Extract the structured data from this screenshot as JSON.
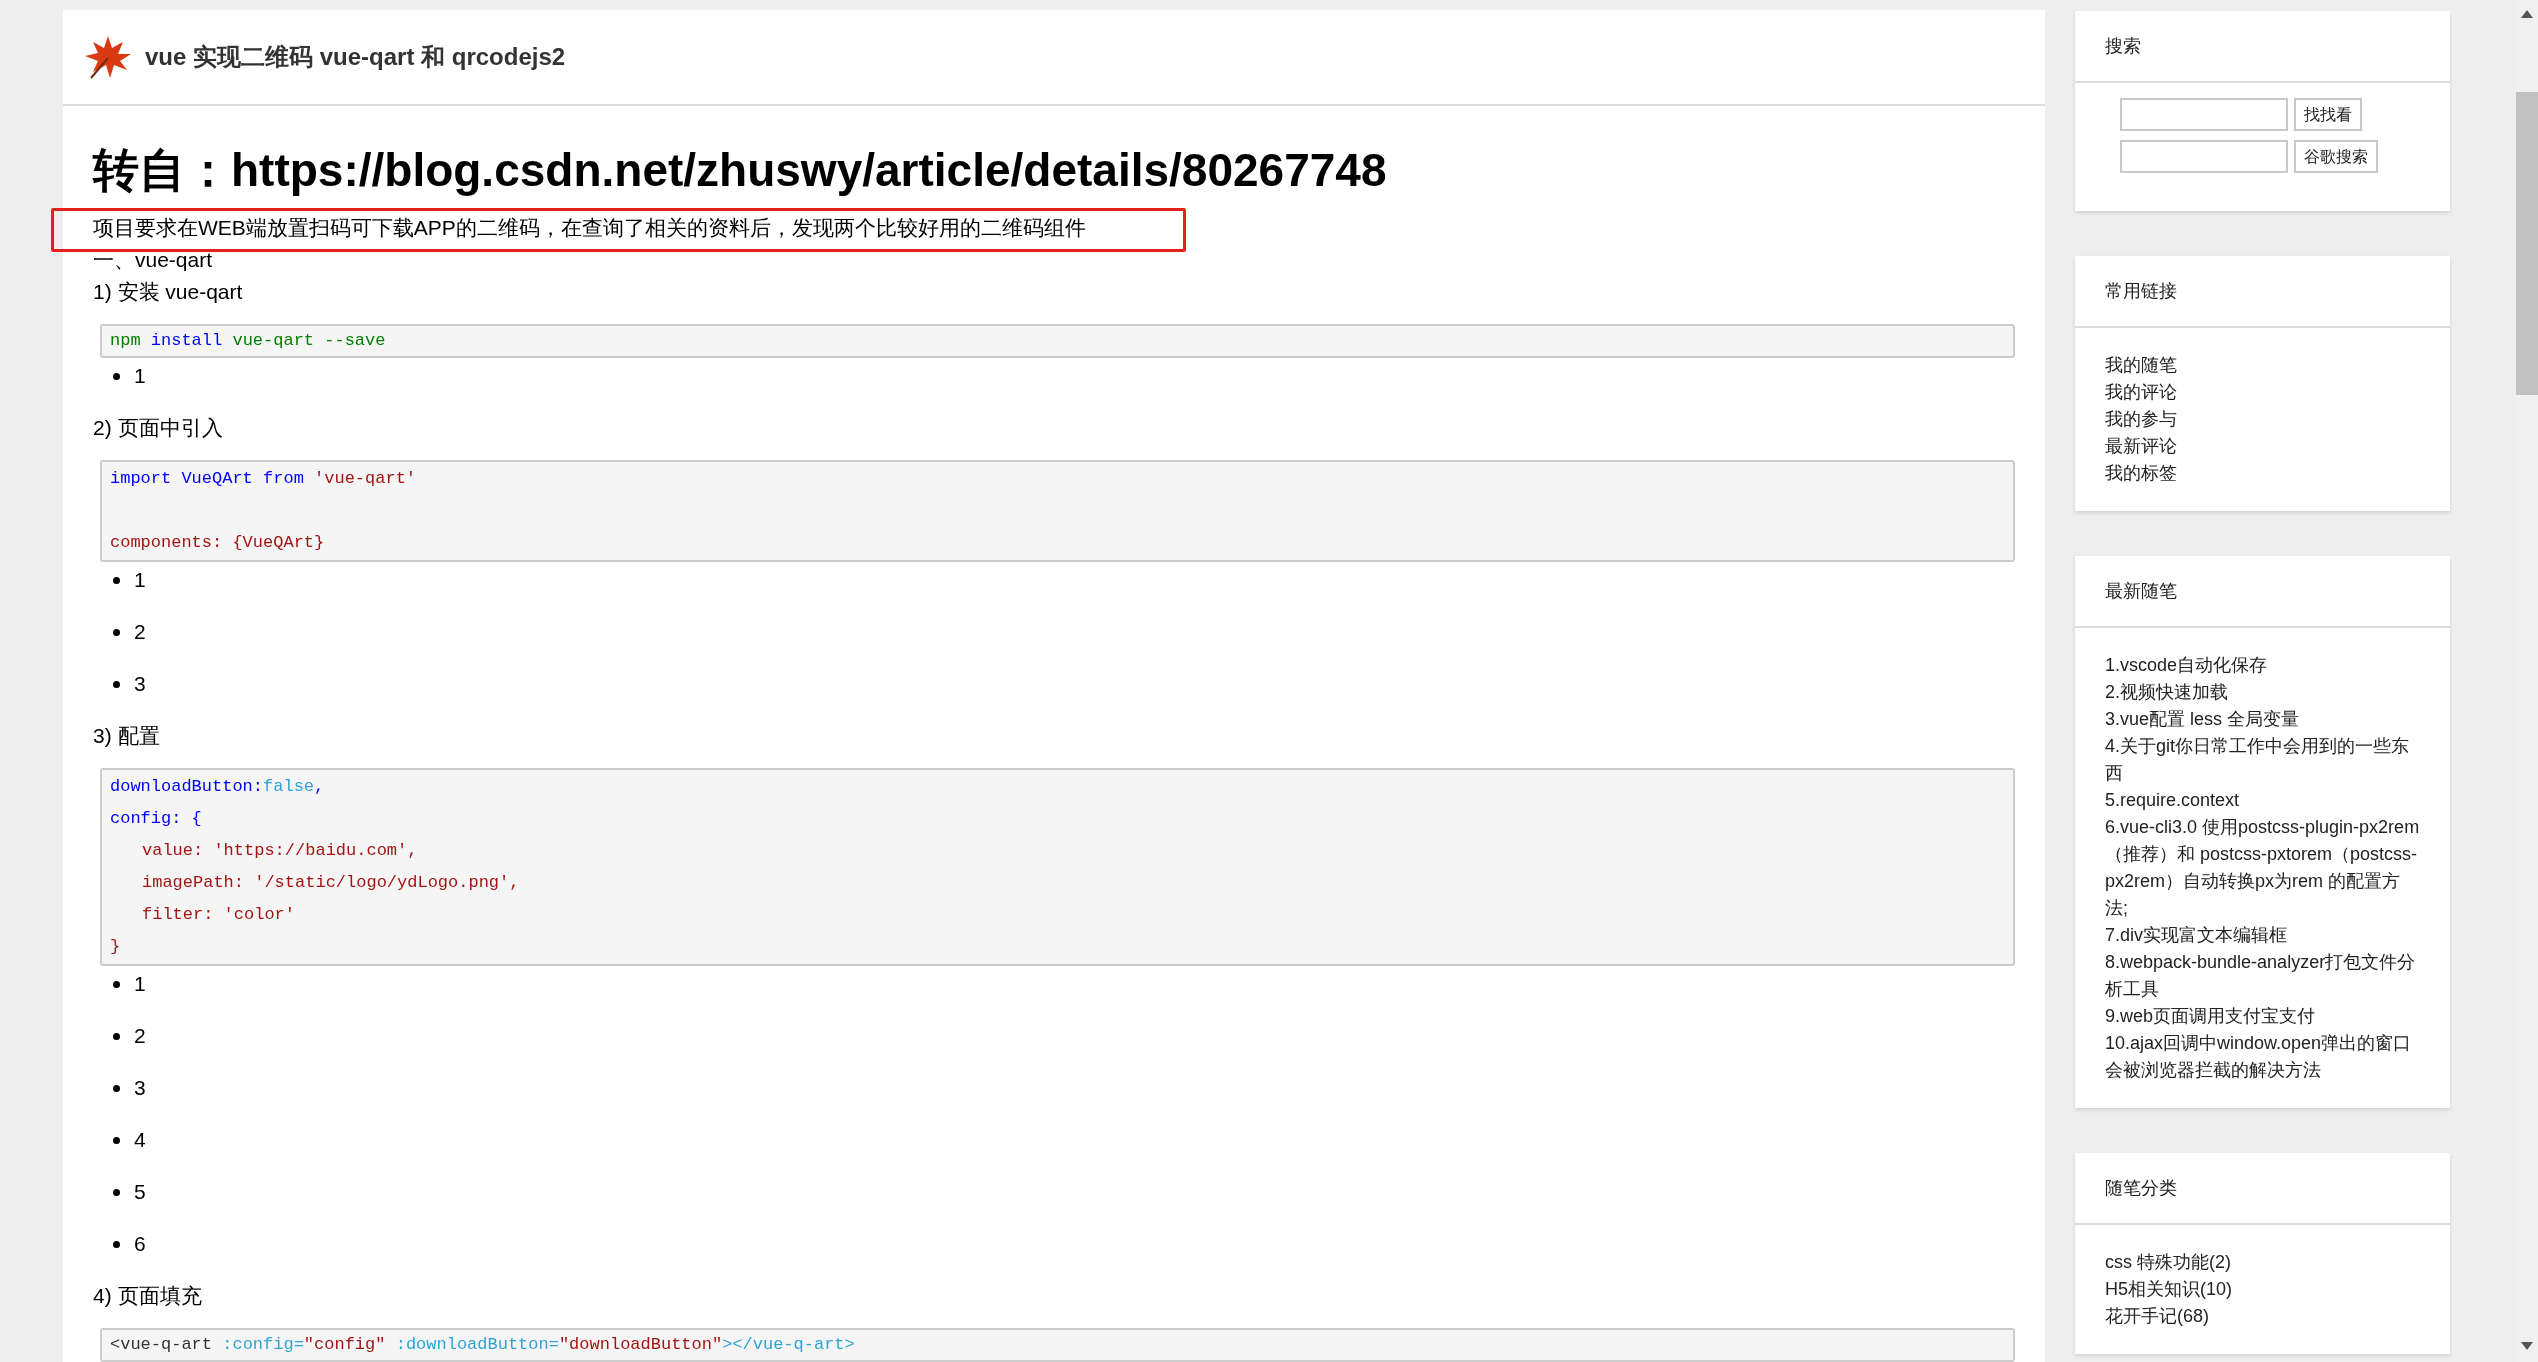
{
  "header": {
    "title": "vue 实现二维码 vue-qart 和 qrcodejs2"
  },
  "article": {
    "title": "转自：https://blog.csdn.net/zhuswy/article/details/80267748",
    "blocks": [
      {
        "kind": "paragraph",
        "text": "项目要求在WEB端放置扫码可下载APP的二维码，在查询了相关的资料后，发现两个比较好用的二维码组件",
        "highlighted": true
      },
      {
        "kind": "paragraph",
        "text": "一、vue-qart",
        "highlighted": false
      },
      {
        "kind": "paragraph",
        "text": "1) 安装 vue-qart",
        "highlighted": false
      },
      {
        "kind": "code",
        "lines": [
          {
            "indent": false,
            "blank_before": false,
            "segments": [
              {
                "kind": "green",
                "text": "npm"
              },
              {
                "kind": "keyword",
                "text": " install"
              },
              {
                "kind": "green",
                "text": " vue-qart --save"
              }
            ]
          }
        ]
      },
      {
        "kind": "bullets",
        "items": [
          "1"
        ]
      },
      {
        "kind": "paragraph",
        "text": "2) 页面中引入",
        "highlighted": false
      },
      {
        "kind": "code",
        "lines": [
          {
            "indent": false,
            "blank_before": false,
            "segments": [
              {
                "kind": "keyword",
                "text": "import VueQArt from"
              },
              {
                "kind": "string",
                "text": " 'vue-qart'"
              }
            ]
          },
          {
            "indent": false,
            "blank_before": true,
            "segments": [
              {
                "kind": "string",
                "text": "components: {VueQArt}"
              }
            ]
          }
        ]
      },
      {
        "kind": "bullets",
        "items": [
          "1",
          "2",
          "3"
        ]
      },
      {
        "kind": "paragraph",
        "text": "3) 配置",
        "highlighted": false
      },
      {
        "kind": "code",
        "lines": [
          {
            "indent": false,
            "blank_before": false,
            "segments": [
              {
                "kind": "keyword",
                "text": "downloadButton:"
              },
              {
                "kind": "attr",
                "text": "false"
              },
              {
                "kind": "keyword",
                "text": ","
              }
            ]
          },
          {
            "indent": false,
            "blank_before": false,
            "segments": [
              {
                "kind": "keyword",
                "text": "config: {"
              }
            ]
          },
          {
            "indent": true,
            "blank_before": false,
            "segments": [
              {
                "kind": "string",
                "text": "value: 'https://baidu.com',"
              }
            ]
          },
          {
            "indent": true,
            "blank_before": false,
            "segments": [
              {
                "kind": "string",
                "text": "imagePath: '/static/logo/ydLogo.png',"
              }
            ]
          },
          {
            "indent": true,
            "blank_before": false,
            "segments": [
              {
                "kind": "string",
                "text": "filter: 'color'"
              }
            ]
          },
          {
            "indent": false,
            "blank_before": false,
            "segments": [
              {
                "kind": "string",
                "text": "}"
              }
            ]
          }
        ]
      },
      {
        "kind": "bullets",
        "items": [
          "1",
          "2",
          "3",
          "4",
          "5",
          "6"
        ]
      },
      {
        "kind": "paragraph",
        "text": "4) 页面填充",
        "highlighted": false
      },
      {
        "kind": "code",
        "lines": [
          {
            "indent": false,
            "blank_before": false,
            "segments": [
              {
                "kind": "text",
                "text": "<vue-q-art"
              },
              {
                "kind": "attr",
                "text": " :config="
              },
              {
                "kind": "string",
                "text": "\"config\""
              },
              {
                "kind": "attr",
                "text": " :downloadButton="
              },
              {
                "kind": "string",
                "text": "\"downloadButton\""
              },
              {
                "kind": "attr",
                "text": "></vue-q-art>"
              }
            ]
          }
        ]
      }
    ]
  },
  "sidebar": {
    "search": {
      "title": "搜索",
      "buttons": [
        "找找看",
        "谷歌搜索"
      ]
    },
    "sections": [
      {
        "title": "常用链接",
        "items": [
          "我的随笔",
          "我的评论",
          "我的参与",
          "最新评论",
          "我的标签"
        ]
      },
      {
        "title": "最新随笔",
        "items": [
          "1.vscode自动化保存",
          "2.视频快速加载",
          "3.vue配置 less 全局变量",
          "4.关于git你日常工作中会用到的一些东西",
          "5.require.context",
          "6.vue-cli3.0 使用postcss-plugin-px2rem（推荐）和 postcss-pxtorem（postcss-px2rem）自动转换px为rem 的配置方法;",
          "7.div实现富文本编辑框",
          "8.webpack-bundle-analyzer打包文件分析工具",
          "9.web页面调用支付宝支付",
          "10.ajax回调中window.open弹出的窗口会被浏览器拦截的解决方法"
        ]
      },
      {
        "title": "随笔分类",
        "items": [
          "css 特殊功能(2)",
          "H5相关知识(10)",
          "花开手记(68)"
        ]
      }
    ]
  }
}
